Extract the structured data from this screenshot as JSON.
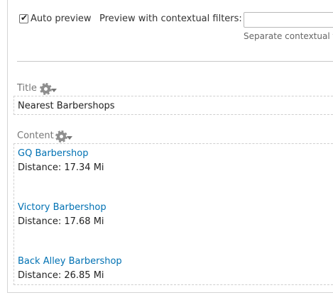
{
  "preview": {
    "auto_preview_label": "Auto preview",
    "auto_preview_checked": true,
    "contextual_filters_label": "Preview with contextual filters:",
    "contextual_filters_value": "",
    "contextual_filters_help": "Separate contextual fi"
  },
  "title_section": {
    "label": "Title",
    "value": "Nearest Barbershops"
  },
  "content_section": {
    "label": "Content",
    "results": [
      {
        "name": "GQ Barbershop",
        "distance": "Distance: 17.34 Mi"
      },
      {
        "name": "Victory Barbershop",
        "distance": "Distance: 17.68 Mi"
      },
      {
        "name": "Back Alley Barbershop",
        "distance": "Distance: 26.85 Mi"
      }
    ]
  },
  "colors": {
    "link": "#0071b3",
    "label": "#777777"
  },
  "icons": [
    "checkbox-checked",
    "gear-icon",
    "caret-down-icon"
  ]
}
